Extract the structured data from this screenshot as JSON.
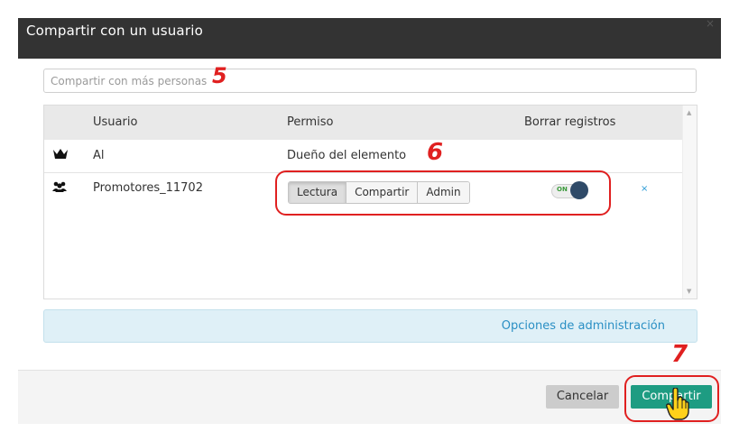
{
  "dialog": {
    "title": "Compartir con un usuario",
    "close_symbol": "×"
  },
  "search": {
    "placeholder": "Compartir con más personas"
  },
  "table": {
    "columns": [
      "Usuario",
      "Permiso",
      "Borrar registros"
    ],
    "rows": [
      {
        "icon": "crown-icon",
        "user": "Al",
        "permission_text": "Dueño del elemento"
      },
      {
        "icon": "group-icon",
        "user": "Promotores_11702",
        "permission_options": [
          "Lectura",
          "Compartir",
          "Admin"
        ],
        "selected_permission": "Lectura",
        "delete_records_toggle": "ON",
        "remove_symbol": "×"
      }
    ]
  },
  "admin_panel": {
    "link": "Opciones de administración"
  },
  "footer": {
    "cancel_label": "Cancelar",
    "share_label": "Compartir"
  },
  "annotations": {
    "step5": "5",
    "step6": "6",
    "step7": "7"
  },
  "colors": {
    "header_bg": "#333333",
    "primary_button": "#1e9c82",
    "annotation": "#e02020",
    "admin_panel_bg": "#dff0f7"
  }
}
